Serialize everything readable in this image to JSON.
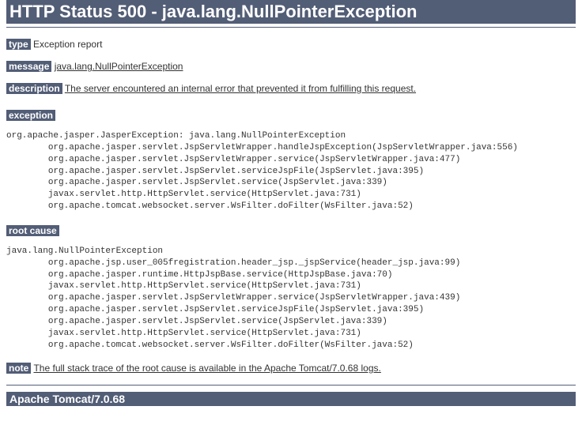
{
  "title": "HTTP Status 500 - java.lang.NullPointerException",
  "type": {
    "label": "type",
    "value": "Exception report"
  },
  "message": {
    "label": "message",
    "value": "java.lang.NullPointerException"
  },
  "description": {
    "label": "description",
    "value": "The server encountered an internal error that prevented it from fulfilling this request."
  },
  "exception": {
    "label": "exception",
    "trace": "org.apache.jasper.JasperException: java.lang.NullPointerException\n\torg.apache.jasper.servlet.JspServletWrapper.handleJspException(JspServletWrapper.java:556)\n\torg.apache.jasper.servlet.JspServletWrapper.service(JspServletWrapper.java:477)\n\torg.apache.jasper.servlet.JspServlet.serviceJspFile(JspServlet.java:395)\n\torg.apache.jasper.servlet.JspServlet.service(JspServlet.java:339)\n\tjavax.servlet.http.HttpServlet.service(HttpServlet.java:731)\n\torg.apache.tomcat.websocket.server.WsFilter.doFilter(WsFilter.java:52)"
  },
  "rootcause": {
    "label": "root cause",
    "trace": "java.lang.NullPointerException\n\torg.apache.jsp.user_005fregistration.header_jsp._jspService(header_jsp.java:99)\n\torg.apache.jasper.runtime.HttpJspBase.service(HttpJspBase.java:70)\n\tjavax.servlet.http.HttpServlet.service(HttpServlet.java:731)\n\torg.apache.jasper.servlet.JspServletWrapper.service(JspServletWrapper.java:439)\n\torg.apache.jasper.servlet.JspServlet.serviceJspFile(JspServlet.java:395)\n\torg.apache.jasper.servlet.JspServlet.service(JspServlet.java:339)\n\tjavax.servlet.http.HttpServlet.service(HttpServlet.java:731)\n\torg.apache.tomcat.websocket.server.WsFilter.doFilter(WsFilter.java:52)"
  },
  "note": {
    "label": "note",
    "value": "The full stack trace of the root cause is available in the Apache Tomcat/7.0.68 logs."
  },
  "server": "Apache Tomcat/7.0.68"
}
